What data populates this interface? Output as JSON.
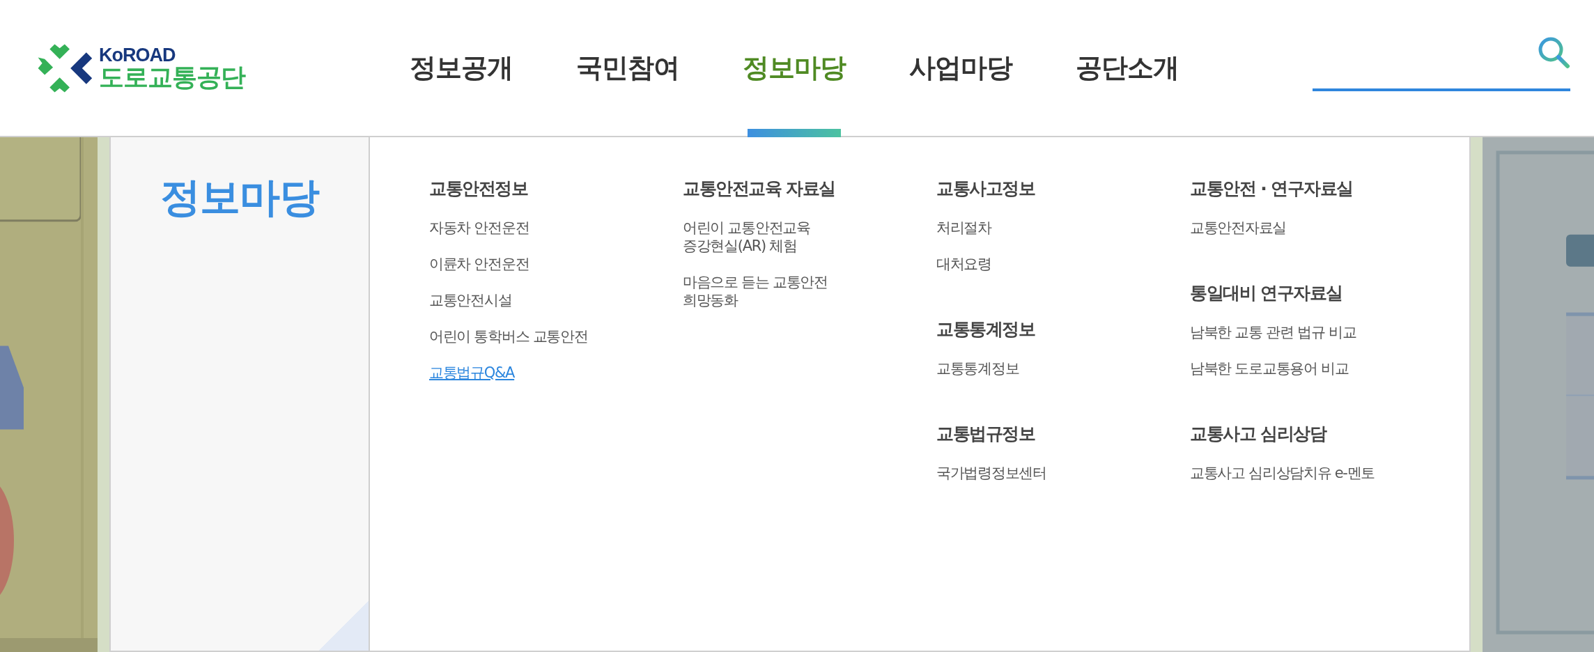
{
  "header": {
    "logo": {
      "brand": "KoROAD",
      "name": "도로교통공단"
    },
    "nav": [
      {
        "label": "정보공개",
        "selected": false
      },
      {
        "label": "국민참여",
        "selected": false
      },
      {
        "label": "정보마당",
        "selected": true
      },
      {
        "label": "사업마당",
        "selected": false
      },
      {
        "label": "공단소개",
        "selected": false
      }
    ]
  },
  "mega_menu": {
    "title": "정보마당",
    "columns": [
      {
        "groups": [
          {
            "heading": "교통안전정보",
            "items": [
              {
                "label": "자동차 안전운전",
                "selected": false
              },
              {
                "label": "이륜차 안전운전",
                "selected": false
              },
              {
                "label": "교통안전시설",
                "selected": false
              },
              {
                "label": "어린이 통학버스 교통안전",
                "selected": false
              },
              {
                "label": "교통법규Q&A",
                "selected": true
              }
            ]
          }
        ]
      },
      {
        "groups": [
          {
            "heading": "교통안전교육 자료실",
            "items": [
              {
                "label": "어린이 교통안전교육\n증강현실(AR) 체험",
                "selected": false
              },
              {
                "label": "마음으로 듣는 교통안전\n희망동화",
                "selected": false
              }
            ]
          }
        ]
      },
      {
        "groups": [
          {
            "heading": "교통사고정보",
            "items": [
              {
                "label": "처리절차",
                "selected": false
              },
              {
                "label": "대처요령",
                "selected": false
              }
            ]
          },
          {
            "heading": "교통통계정보",
            "items": [
              {
                "label": "교통통계정보",
                "selected": false
              }
            ]
          },
          {
            "heading": "교통법규정보",
            "items": [
              {
                "label": "국가법령정보센터",
                "selected": false
              }
            ]
          }
        ]
      },
      {
        "groups": [
          {
            "heading": "교통안전 · 연구자료실",
            "items": [
              {
                "label": "교통안전자료실",
                "selected": false
              }
            ]
          },
          {
            "heading": "통일대비 연구자료실",
            "items": [
              {
                "label": "남북한 교통 관련 법규 비교",
                "selected": false
              },
              {
                "label": "남북한 도로교통용어 비교",
                "selected": false
              }
            ]
          },
          {
            "heading": "교통사고 심리상담",
            "items": [
              {
                "label": "교통사고 심리상담치유 e-멘토",
                "selected": false
              }
            ]
          }
        ]
      }
    ]
  }
}
